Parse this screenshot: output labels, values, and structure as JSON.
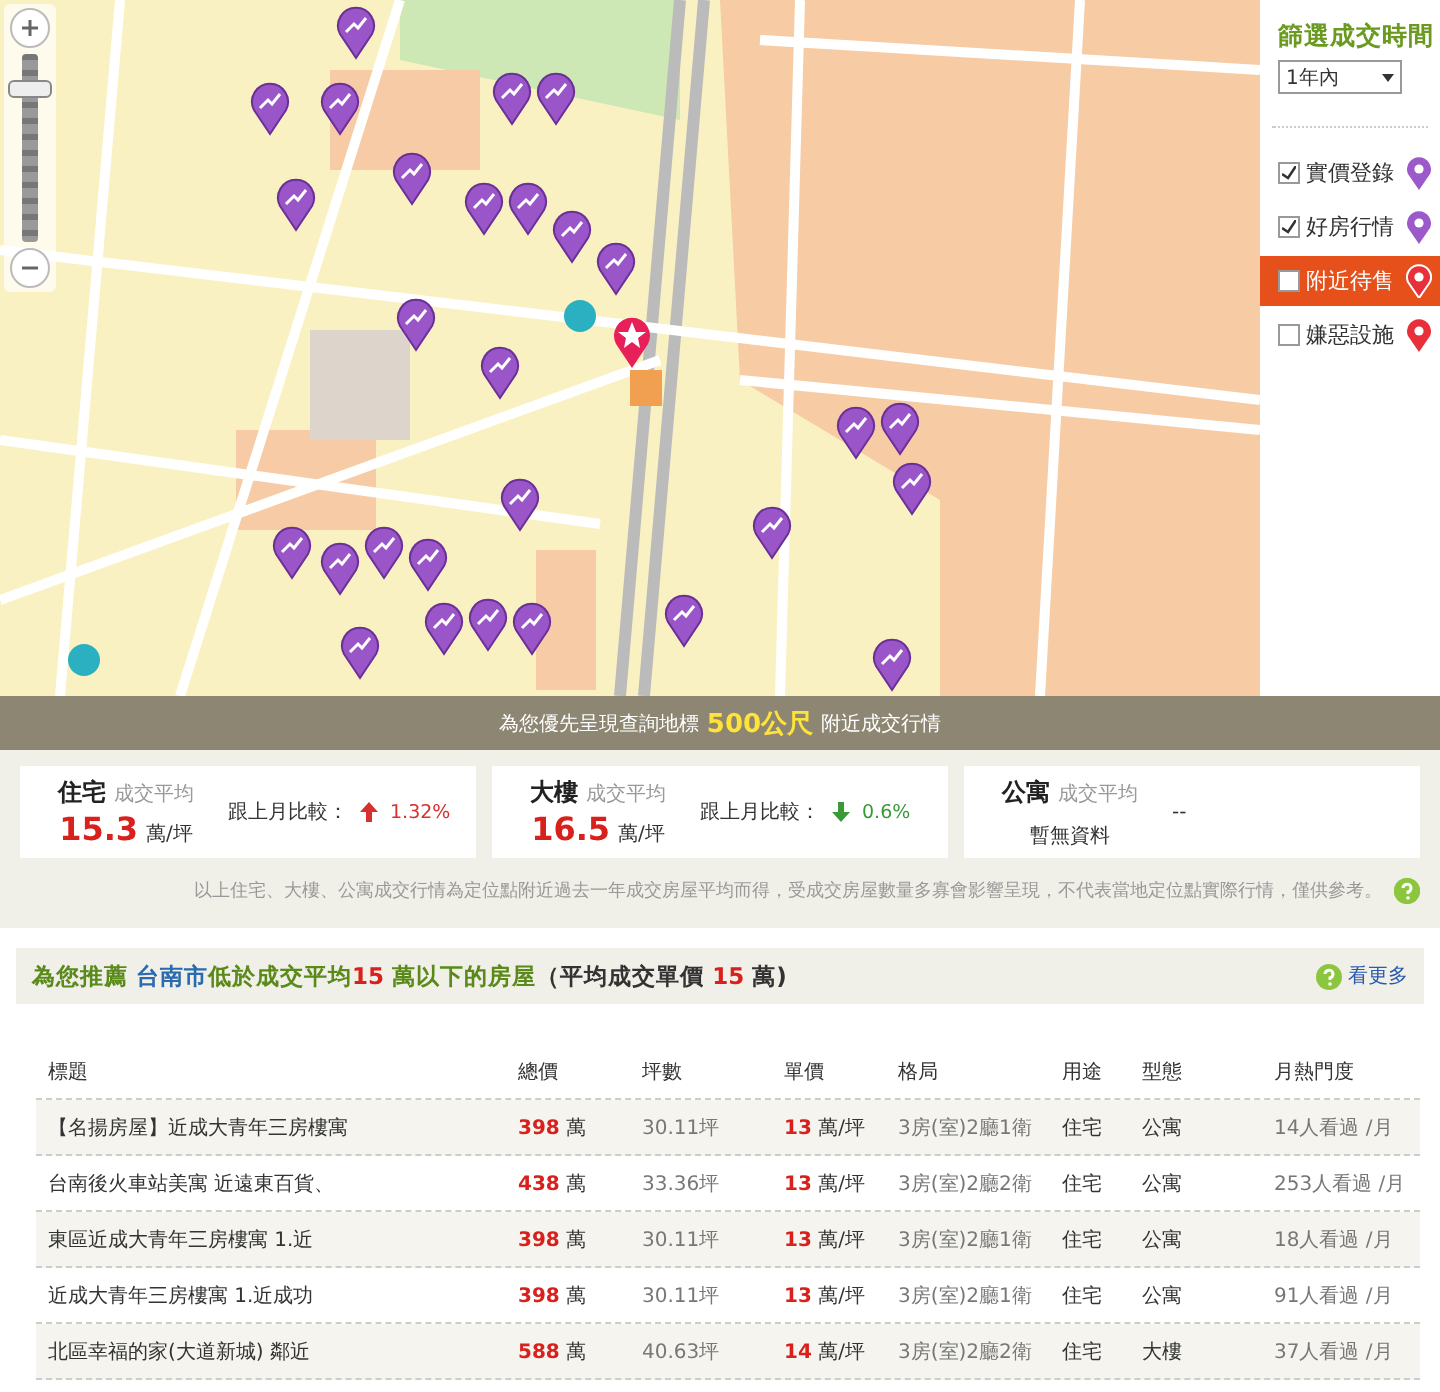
{
  "map": {
    "kind": "picture",
    "zoom": {
      "level": 0.85
    }
  },
  "filter": {
    "title": "篩選成交時間",
    "period": "1年內",
    "layers": [
      {
        "label": "實價登錄",
        "checked": true,
        "selected": false,
        "color": "#9b59c9"
      },
      {
        "label": "好房行情",
        "checked": true,
        "selected": false,
        "color": "#9b59c9"
      },
      {
        "label": "附近待售",
        "checked": false,
        "selected": true,
        "color": "#e8303a"
      },
      {
        "label": "嫌惡設施",
        "checked": false,
        "selected": false,
        "color": "#e8303a"
      }
    ]
  },
  "banner": {
    "prefix": "為您優先呈現查詢地標",
    "distance": "500公尺",
    "suffix": "附近成交行情"
  },
  "stats": [
    {
      "kind": "price",
      "type": "住宅",
      "label": "成交平均",
      "price": "15.3",
      "unit": "萬/坪",
      "compare_label": "跟上月比較：",
      "rising": true,
      "change": "1.32%"
    },
    {
      "kind": "price",
      "type": "大樓",
      "label": "成交平均",
      "price": "16.5",
      "unit": "萬/坪",
      "compare_label": "跟上月比較：",
      "rising": false,
      "change": "0.6%"
    },
    {
      "kind": "empty",
      "type": "公寓",
      "label": "成交平均",
      "dash": "--",
      "no_data": "暫無資料"
    }
  ],
  "note": "以上住宅、大樓、公寓成交行情為定位點附近過去一年成交房屋平均而得，受成交房屋數量多寡會影響呈現，不代表當地定位點實際行情，僅供參考。",
  "recommend": {
    "title": [
      {
        "kind": "green",
        "text": "為您推薦 "
      },
      {
        "kind": "blue",
        "text": "台南市"
      },
      {
        "kind": "green",
        "text": "低於成交平均"
      },
      {
        "kind": "red",
        "text": "15"
      },
      {
        "kind": "green",
        "text": " 萬以下的房屋"
      },
      {
        "kind": "dark",
        "text": "（平均成交單價 "
      },
      {
        "kind": "red",
        "text": "15"
      },
      {
        "kind": "dark",
        "text": " 萬)"
      }
    ],
    "more": "看更多",
    "columns": [
      "標題",
      "總價",
      "坪數",
      "單價",
      "格局",
      "用途",
      "型態",
      "月熱門度"
    ],
    "rows": [
      {
        "title": "【名揚房屋】近成大青年三房樓寓",
        "price": "398",
        "price_unit": "萬",
        "area": "30.11坪",
        "unit_price": "13",
        "unit_price_unit": "萬/坪",
        "layout": "3房(室)2廳1衛",
        "use": "住宅",
        "type": "公寓",
        "views": "14人看過 /月"
      },
      {
        "title": "台南後火車站美寓 近遠東百貨、",
        "price": "438",
        "price_unit": "萬",
        "area": "33.36坪",
        "unit_price": "13",
        "unit_price_unit": "萬/坪",
        "layout": "3房(室)2廳2衛",
        "use": "住宅",
        "type": "公寓",
        "views": "253人看過 /月"
      },
      {
        "title": "東區近成大青年三房樓寓 1.近",
        "price": "398",
        "price_unit": "萬",
        "area": "30.11坪",
        "unit_price": "13",
        "unit_price_unit": "萬/坪",
        "layout": "3房(室)2廳1衛",
        "use": "住宅",
        "type": "公寓",
        "views": "18人看過 /月"
      },
      {
        "title": "近成大青年三房樓寓 1.近成功",
        "price": "398",
        "price_unit": "萬",
        "area": "30.11坪",
        "unit_price": "13",
        "unit_price_unit": "萬/坪",
        "layout": "3房(室)2廳1衛",
        "use": "住宅",
        "type": "公寓",
        "views": "91人看過 /月"
      },
      {
        "title": "北區幸福的家(大道新城) 鄰近",
        "price": "588",
        "price_unit": "萬",
        "area": "40.63坪",
        "unit_price": "14",
        "unit_price_unit": "萬/坪",
        "layout": "3房(室)2廳2衛",
        "use": "住宅",
        "type": "大樓",
        "views": "37人看過 /月"
      }
    ]
  }
}
